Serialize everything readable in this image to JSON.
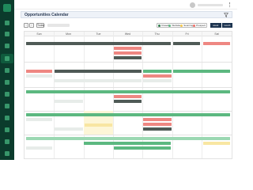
{
  "header": {
    "title": "Opportunities Calendar",
    "user_name": "",
    "filter_icon": "filter-icon",
    "menu_icon": "more-vertical-icon"
  },
  "toolbar": {
    "prev_label": "‹",
    "next_label": "›",
    "today_label": "Today",
    "date_range": ""
  },
  "legend": {
    "items": [
      {
        "label": "Closed",
        "color": "#2f7a4c"
      },
      {
        "label": "Website",
        "color": "#5cb880"
      },
      {
        "label": "Sourcing",
        "color": "#f4c94f"
      },
      {
        "label": "Prospect",
        "color": "#ee6f68"
      }
    ]
  },
  "views": [
    "week",
    "month"
  ],
  "calendar": {
    "days": [
      "Sun",
      "Mon",
      "Tue",
      "Wed",
      "Thu",
      "Fri",
      "Sat"
    ]
  },
  "colors": {
    "sidebar": "#0b3b2c",
    "accent": "#1d3450",
    "event_green": "#5cb880",
    "event_dark": "#4f5a56",
    "event_red": "#ee8782",
    "event_yellow": "#f8e6a2"
  }
}
